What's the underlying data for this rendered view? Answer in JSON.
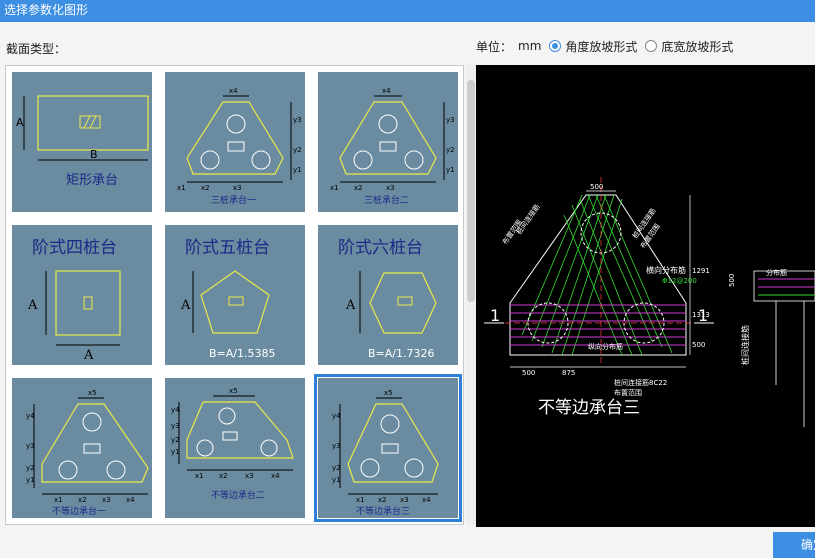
{
  "window": {
    "title": "选择参数化图形"
  },
  "section": {
    "label": "截面类型："
  },
  "unit": {
    "label": "单位：",
    "value": "mm",
    "options": [
      {
        "label": "角度放坡形式",
        "checked": true
      },
      {
        "label": "底宽放坡形式",
        "checked": false
      }
    ]
  },
  "shapes": [
    {
      "name": "矩形承台",
      "dims": [
        "A",
        "B"
      ]
    },
    {
      "name": "三桩承台一",
      "dims": [
        "x4",
        "y3",
        "y2",
        "y1",
        "x1",
        "x2",
        "x3"
      ]
    },
    {
      "name": "三桩承台二",
      "dims": [
        "x4",
        "y3",
        "y2",
        "y1",
        "x1",
        "x2",
        "x3"
      ]
    },
    {
      "name": "阶式四桩台",
      "dims": [
        "A",
        "A"
      ]
    },
    {
      "name": "阶式五桩台",
      "dims": [
        "A"
      ],
      "formula": "B=A/1.5385"
    },
    {
      "name": "阶式六桩台",
      "dims": [
        "A"
      ],
      "formula": "B=A/1.7326"
    },
    {
      "name": "不等边承台一",
      "dims": [
        "x5",
        "y4",
        "y3",
        "y2",
        "y1",
        "x1",
        "x2",
        "x3",
        "x4"
      ]
    },
    {
      "name": "不等边承台二",
      "dims": [
        "x5",
        "y4",
        "y3",
        "y2",
        "y1",
        "x1",
        "x2",
        "x3",
        "x4"
      ]
    },
    {
      "name": "不等边承台三",
      "dims": [
        "x5",
        "y4",
        "y3",
        "y2",
        "y1",
        "x1",
        "x2",
        "x3",
        "x4"
      ],
      "selected": true
    }
  ],
  "preview": {
    "title": "不等边承台三",
    "section_mark": "1",
    "labels": {
      "tie_left": "桩间连接筋",
      "tie_right": "桩间连接筋",
      "dist_left": "布置范围",
      "dist_right": "布置范围",
      "rebar_right": "横向分布筋",
      "rebar_value": "Φ12@200",
      "rebar_bottom": "纵向分布筋",
      "tie_bottom": "桩间连接筋8C22",
      "range_bottom": "布置范围",
      "side_dist": "分布筋",
      "side_label": "桩间连接筋",
      "dim_top": "500",
      "dim_b1": "500",
      "dim_b2": "875",
      "dim_right1": "1291",
      "dim_right2": "1313",
      "dim_right3": "500",
      "dim_side": "500"
    }
  },
  "buttons": {
    "ok": "确定"
  }
}
